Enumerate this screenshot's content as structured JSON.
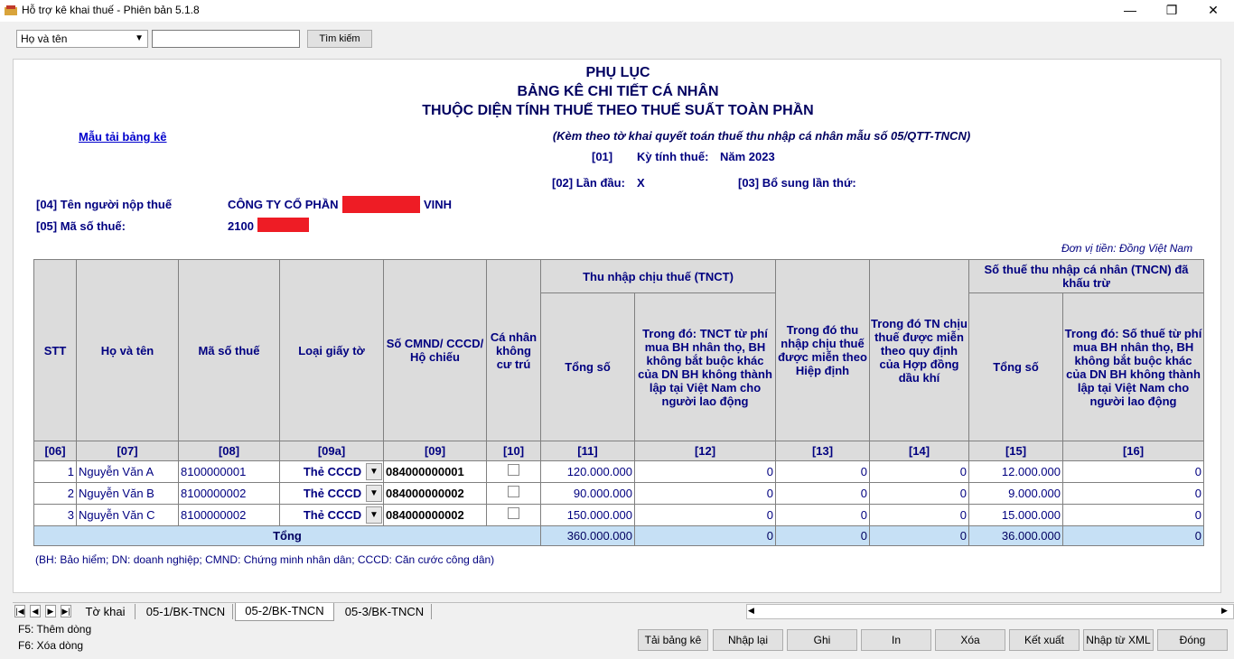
{
  "window": {
    "title": "Hỗ trợ kê khai thuế -  Phiên bản 5.1.8",
    "minimize": "—",
    "maximize": "❐",
    "close": "✕"
  },
  "search": {
    "field_select": "Họ và tên",
    "input_value": "",
    "button": "Tìm kiếm"
  },
  "doc": {
    "title1": "PHỤ LỤC",
    "title2": "BẢNG KÊ CHI TIẾT CÁ NHÂN",
    "title3": "THUỘC DIỆN TÍNH THUẾ THEO THUẾ SUẤT TOÀN PHẦN",
    "subtitle": "(Kèm theo tờ khai quyết toán thuế thu nhập cá nhân mẫu số 05/QTT-TNCN)",
    "template_link": "Mẫu tải bảng kê",
    "period_code": "[01]",
    "period_label": "Kỳ tính thuế:",
    "period_value": "Năm 2023",
    "first_time_label": "[02] Lần đầu:",
    "first_time_value": "X",
    "supplement_label": "[03] Bổ sung lần thứ:",
    "taxpayer_label": "[04] Tên người nộp thuế",
    "taxpayer_name_prefix": "CÔNG TY CỔ PHẦN",
    "taxpayer_name_suffix": "VINH",
    "tax_code_label": "[05] Mã số thuế:",
    "tax_code_prefix": "2100",
    "currency_note": "Đơn vị tiền: Đồng Việt Nam",
    "footnote": "(BH: Bảo hiểm; DN: doanh nghiệp; CMND: Chứng minh nhân dân; CCCD: Căn cước công dân)",
    "redaction_color": "#ee1c25"
  },
  "table": {
    "headers": {
      "stt": "STT",
      "name": "Họ và tên",
      "tax_code": "Mã số thuế",
      "doc_type": "Loại giấy tờ",
      "id_no": "Số CMND/ CCCD/ Hộ chiếu",
      "non_resident": "Cá nhân không cư trú",
      "tnct_group": "Thu nhập chịu thuế (TNCT)",
      "tnct_total": "Tổng số",
      "tnct_insurance": "Trong đó: TNCT từ phí mua BH nhân thọ, BH không bắt buộc khác của DN BH không thành lập tại Việt Nam cho người lao động",
      "treaty_exempt": "Trong đó thu nhập chịu thuế được miễn theo Hiệp định",
      "oil_exempt": "Trong đó TN chịu thuế được miễn theo quy định của Hợp đồng dầu khí",
      "pit_group": "Số thuế thu nhập cá nhân (TNCN) đã khấu trừ",
      "pit_total": "Tổng số",
      "pit_insurance": "Trong đó: Số thuế từ phí mua BH nhân thọ, BH không bắt buộc khác của DN BH không thành lập tại Việt Nam cho người lao động"
    },
    "codes": [
      "[06]",
      "[07]",
      "[08]",
      "[09a]",
      "[09]",
      "[10]",
      "[11]",
      "[12]",
      "[13]",
      "[14]",
      "[15]",
      "[16]"
    ],
    "rows": [
      {
        "stt": "1",
        "name": "Nguyễn Văn A",
        "tax_code": "8100000001",
        "doc_type": "Thẻ CCCD",
        "id_no": "084000000001",
        "non_resident": false,
        "c11": "120.000.000",
        "c12": "0",
        "c13": "0",
        "c14": "0",
        "c15": "12.000.000",
        "c16": "0"
      },
      {
        "stt": "2",
        "name": "Nguyễn Văn B",
        "tax_code": "8100000002",
        "doc_type": "Thẻ CCCD",
        "id_no": "084000000002",
        "non_resident": false,
        "c11": "90.000.000",
        "c12": "0",
        "c13": "0",
        "c14": "0",
        "c15": "9.000.000",
        "c16": "0"
      },
      {
        "stt": "3",
        "name": "Nguyễn Văn C",
        "tax_code": "8100000002",
        "doc_type": "Thẻ CCCD",
        "id_no": "084000000002",
        "non_resident": false,
        "c11": "150.000.000",
        "c12": "0",
        "c13": "0",
        "c14": "0",
        "c15": "15.000.000",
        "c16": "0"
      }
    ],
    "total": {
      "label": "Tổng",
      "c11": "360.000.000",
      "c12": "0",
      "c13": "0",
      "c14": "0",
      "c15": "36.000.000",
      "c16": "0"
    }
  },
  "tabs": [
    "Tờ khai",
    "05-1/BK-TNCN",
    "05-2/BK-TNCN",
    "05-3/BK-TNCN"
  ],
  "active_tab": "05-2/BK-TNCN",
  "shortcuts": [
    "F5: Thêm dòng",
    "F6: Xóa dòng"
  ],
  "buttons": [
    "Tải bảng kê",
    "Nhập lại",
    "Ghi",
    "In",
    "Xóa",
    "Kết xuất",
    "Nhập từ XML",
    "Đóng"
  ]
}
